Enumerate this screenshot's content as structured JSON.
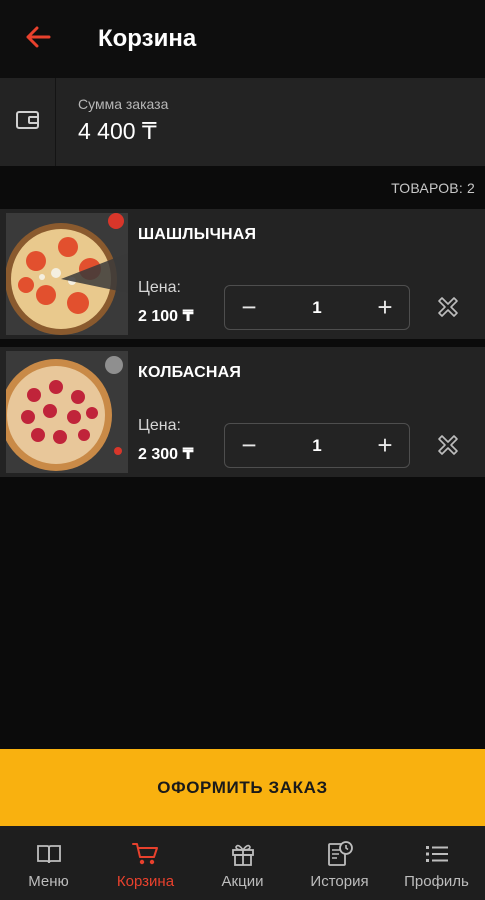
{
  "header": {
    "title": "Корзина"
  },
  "summary": {
    "label": "Сумма заказа",
    "value": "4 400 ₸"
  },
  "items_count": "ТОВАРОВ: 2",
  "cart": {
    "items": [
      {
        "name": "ШАШЛЫЧНАЯ",
        "price_label": "Цена:",
        "price": "2 100 ₸",
        "quantity": "1",
        "minus": "−",
        "plus": "+"
      },
      {
        "name": "КОЛБАСНАЯ",
        "price_label": "Цена:",
        "price": "2 300 ₸",
        "quantity": "1",
        "minus": "−",
        "plus": "+"
      }
    ]
  },
  "checkout": {
    "label": "ОФОРМИТЬ ЗАКАЗ"
  },
  "nav": {
    "items": [
      {
        "label": "Меню",
        "icon": "book-icon"
      },
      {
        "label": "Корзина",
        "icon": "cart-icon"
      },
      {
        "label": "Акции",
        "icon": "gift-icon"
      },
      {
        "label": "История",
        "icon": "history-icon"
      },
      {
        "label": "Профиль",
        "icon": "list-icon"
      }
    ],
    "active": "Корзина"
  },
  "colors": {
    "accent": "#e8412d",
    "checkout_bg": "#f9b10f",
    "background": "#0b0b0b",
    "card": "#232323"
  }
}
